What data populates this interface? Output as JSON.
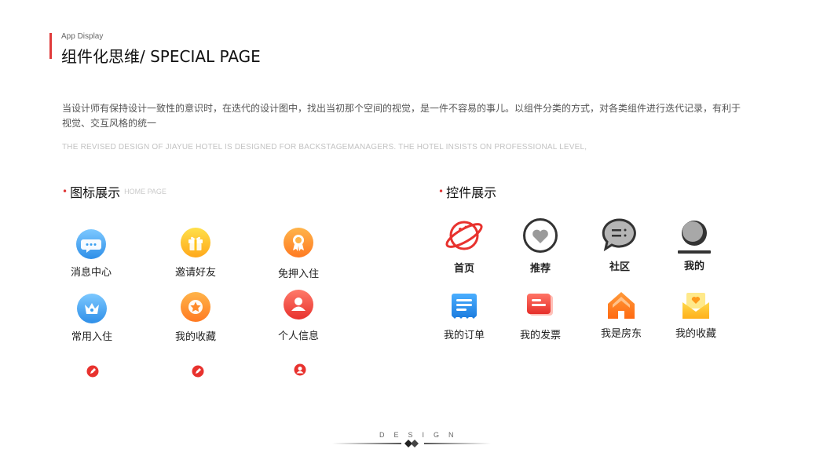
{
  "header": {
    "eyebrow": "App Display",
    "title": "组件化思维/ SPECIAL PAGE",
    "description": "当设计师有保持设计一致性的意识时，在迭代的设计图中，找出当初那个空间的视觉，是一件不容易的事儿。以组件分类的方式，对各类组件进行迭代记录，有利于视觉、交互风格的统一",
    "description_en": "THE REVISED DESIGN OF JIAYUE HOTEL IS DESIGNED FOR BACKSTAGEMANAGERS. THE HOTEL INSISTS ON PROFESSIONAL LEVEL,"
  },
  "icon_section": {
    "title": "图标展示",
    "subtitle": "HOME PAGE",
    "items": [
      {
        "label": "消息中心",
        "icon": "message-bubble-icon"
      },
      {
        "label": "邀请好友",
        "icon": "gift-icon"
      },
      {
        "label": "免押入住",
        "icon": "badge-icon"
      },
      {
        "label": "常用入住",
        "icon": "crown-icon"
      },
      {
        "label": "我的收藏",
        "icon": "star-icon"
      },
      {
        "label": "个人信息",
        "icon": "user-icon"
      }
    ],
    "small_icons": [
      "pencil-icon",
      "pencil-icon",
      "user-icon"
    ]
  },
  "control_section": {
    "title": "控件展示",
    "tabs": [
      {
        "label": "首页",
        "icon": "planet-icon"
      },
      {
        "label": "推荐",
        "icon": "heart-icon"
      },
      {
        "label": "社区",
        "icon": "chat-icon"
      },
      {
        "label": "我的",
        "icon": "profile-icon"
      }
    ],
    "items": [
      {
        "label": "我的订单",
        "icon": "order-icon"
      },
      {
        "label": "我的发票",
        "icon": "invoice-icon"
      },
      {
        "label": "我是房东",
        "icon": "house-icon"
      },
      {
        "label": "我的收藏",
        "icon": "favorite-mail-icon"
      }
    ]
  },
  "footer": {
    "text": "DESIGN"
  },
  "colors": {
    "accent": "#e03a3a",
    "blue": "#3a9ff0",
    "yellow": "#ffc41d",
    "orange": "#ff8a2a",
    "red": "#f0463c"
  }
}
